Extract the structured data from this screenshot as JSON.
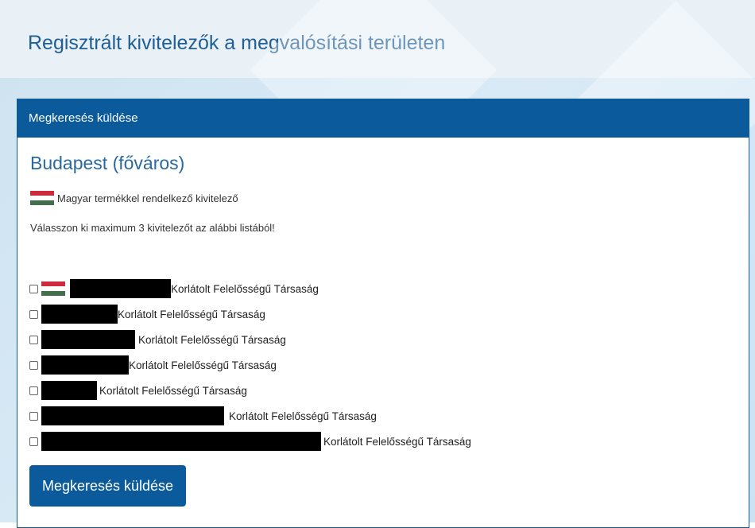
{
  "page": {
    "title": "Regisztrált kivitelezők a megvalósítási területen"
  },
  "panel": {
    "header": "Megkeresés küldése",
    "city": "Budapest (főváros)",
    "legend_text": "Magyar termékkel rendelkező kivitelező",
    "instruction": "Válasszon ki maximum 3 kivitelezőt az alábbi listából!",
    "contractors": [
      {
        "name_suffix": "Korlátolt Felelősségű Társaság",
        "hungarian_product": true,
        "checked": false
      },
      {
        "name_suffix": "Korlátolt Felelősségű Társaság",
        "hungarian_product": false,
        "checked": false
      },
      {
        "name_suffix": "Korlátolt Felelősségű Társaság",
        "hungarian_product": false,
        "checked": false
      },
      {
        "name_suffix": "Korlátolt Felelősségű Társaság",
        "hungarian_product": false,
        "checked": false
      },
      {
        "name_suffix": "Korlátolt Felelősségű Társaság",
        "hungarian_product": false,
        "checked": false
      },
      {
        "name_suffix": "Korlátolt Felelősségű Társaság",
        "hungarian_product": false,
        "checked": false
      },
      {
        "name_suffix": "Korlátolt Felelősségű Társaság",
        "hungarian_product": false,
        "checked": false
      }
    ],
    "submit_label": "Megkeresés küldése"
  },
  "colors": {
    "primary": "#0b5b9c",
    "title_text": "#1f5f96",
    "header_band": "#e9f1f7",
    "flag_red": "#cd2a3e",
    "flag_green": "#436f4d"
  },
  "icons": {
    "hungarian_flag": "hungarian-flag-icon"
  }
}
